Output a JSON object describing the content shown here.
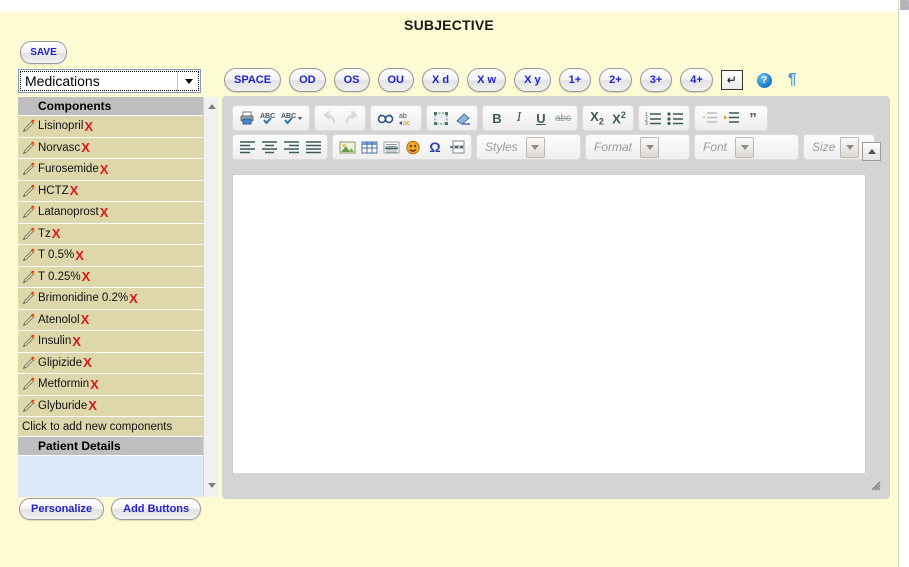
{
  "page": {
    "title": "SUBJECTIVE",
    "background_color": "#fdfbd3"
  },
  "sidebar": {
    "save_label": "SAVE",
    "select": {
      "value": "Medications",
      "arrow_icon": "chevron-down-icon"
    },
    "components_header": "Components",
    "items": [
      {
        "label": "Lisinopril",
        "edit_icon": "pencil-icon",
        "delete_icon": "x-mark-icon"
      },
      {
        "label": "Norvasc",
        "edit_icon": "pencil-icon",
        "delete_icon": "x-mark-icon"
      },
      {
        "label": "Furosemide",
        "edit_icon": "pencil-icon",
        "delete_icon": "x-mark-icon"
      },
      {
        "label": "HCTZ",
        "edit_icon": "pencil-icon",
        "delete_icon": "x-mark-icon"
      },
      {
        "label": "Latanoprost",
        "edit_icon": "pencil-icon",
        "delete_icon": "x-mark-icon"
      },
      {
        "label": "Tz",
        "edit_icon": "pencil-icon",
        "delete_icon": "x-mark-icon"
      },
      {
        "label": "T 0.5%",
        "edit_icon": "pencil-icon",
        "delete_icon": "x-mark-icon"
      },
      {
        "label": "T 0.25%",
        "edit_icon": "pencil-icon",
        "delete_icon": "x-mark-icon"
      },
      {
        "label": "Brimonidine 0.2%",
        "edit_icon": "pencil-icon",
        "delete_icon": "x-mark-icon"
      },
      {
        "label": "Atenolol",
        "edit_icon": "pencil-icon",
        "delete_icon": "x-mark-icon"
      },
      {
        "label": "Insulin",
        "edit_icon": "pencil-icon",
        "delete_icon": "x-mark-icon"
      },
      {
        "label": "Glipizide",
        "edit_icon": "pencil-icon",
        "delete_icon": "x-mark-icon"
      },
      {
        "label": "Metformin",
        "edit_icon": "pencil-icon",
        "delete_icon": "x-mark-icon"
      },
      {
        "label": "Glyburide",
        "edit_icon": "pencil-icon",
        "delete_icon": "x-mark-icon"
      }
    ],
    "add_new_label": "Click to add new components",
    "patient_details_header": "Patient Details",
    "scrollbar": {
      "up_icon": "triangle-up-icon",
      "down_icon": "triangle-down-icon"
    },
    "personalize_label": "Personalize",
    "add_buttons_label": "Add Buttons"
  },
  "quick_bar": {
    "buttons": [
      {
        "label": "SPACE"
      },
      {
        "label": "OD"
      },
      {
        "label": "OS"
      },
      {
        "label": "OU"
      },
      {
        "label": "X d"
      },
      {
        "label": "X w"
      },
      {
        "label": "X y"
      },
      {
        "label": "1+"
      },
      {
        "label": "2+"
      },
      {
        "label": "3+"
      },
      {
        "label": "4+"
      }
    ],
    "enter_label": "↵",
    "enter_icon": "enter-key-icon",
    "help_label": "?",
    "help_icon": "help-circle-icon",
    "pilcrow_label": "¶",
    "pilcrow_icon": "pilcrow-icon"
  },
  "editor": {
    "toolbar_row1": [
      {
        "name": "print-icon",
        "tip": "Print"
      },
      {
        "name": "spellcheck-icon",
        "tip": "Check Spelling"
      },
      {
        "name": "spellcheck-options-icon",
        "tip": "Spell Check As You Type"
      },
      {
        "name": "undo-icon",
        "tip": "Undo",
        "disabled": true
      },
      {
        "name": "redo-icon",
        "tip": "Redo",
        "disabled": true
      },
      {
        "name": "find-icon",
        "tip": "Find"
      },
      {
        "name": "replace-icon",
        "tip": "Replace"
      },
      {
        "name": "select-all-icon",
        "tip": "Select All"
      },
      {
        "name": "remove-format-icon",
        "tip": "Remove Format"
      },
      {
        "name": "bold-icon",
        "label": "B",
        "tip": "Bold"
      },
      {
        "name": "italic-icon",
        "label": "I",
        "tip": "Italic"
      },
      {
        "name": "underline-icon",
        "label": "U",
        "tip": "Underline"
      },
      {
        "name": "strikethrough-icon",
        "label": "abc",
        "tip": "Strike Through"
      },
      {
        "name": "subscript-icon",
        "tip": "Subscript"
      },
      {
        "name": "superscript-icon",
        "tip": "Superscript"
      },
      {
        "name": "numbered-list-icon",
        "tip": "Insert/Remove Numbered List"
      },
      {
        "name": "bulleted-list-icon",
        "tip": "Insert/Remove Bulleted List"
      },
      {
        "name": "outdent-icon",
        "tip": "Decrease Indent",
        "disabled": true
      },
      {
        "name": "indent-icon",
        "tip": "Increase Indent"
      },
      {
        "name": "blockquote-icon",
        "tip": "Block Quote"
      }
    ],
    "toolbar_row2": [
      {
        "name": "align-left-icon",
        "tip": "Align Left"
      },
      {
        "name": "align-center-icon",
        "tip": "Center"
      },
      {
        "name": "align-right-icon",
        "tip": "Align Right"
      },
      {
        "name": "justify-icon",
        "tip": "Justify"
      },
      {
        "name": "image-icon",
        "tip": "Image"
      },
      {
        "name": "table-icon",
        "tip": "Table"
      },
      {
        "name": "horizontal-rule-icon",
        "tip": "Horizontal Line"
      },
      {
        "name": "smiley-icon",
        "tip": "Smiley"
      },
      {
        "name": "special-character-icon",
        "tip": "Insert Special Character"
      },
      {
        "name": "page-break-icon",
        "tip": "Page Break"
      }
    ],
    "combos": [
      {
        "name": "styles-combo",
        "label": "Styles"
      },
      {
        "name": "format-combo",
        "label": "Format"
      },
      {
        "name": "font-combo",
        "label": "Font"
      },
      {
        "name": "size-combo",
        "label": "Size"
      }
    ],
    "collapse_icon": "triangle-up-icon",
    "content": "",
    "resize_icon": "resize-grip-icon"
  }
}
